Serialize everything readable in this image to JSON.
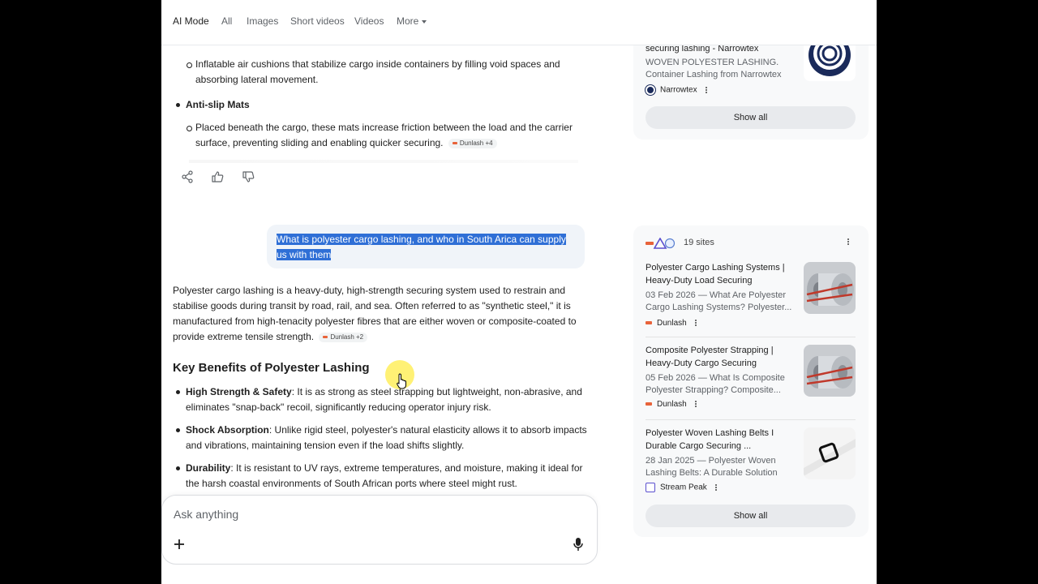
{
  "nav": {
    "tabs": [
      "AI Mode",
      "All",
      "Images",
      "Short videos",
      "Videos",
      "More"
    ]
  },
  "main": {
    "cushion_text": "Inflatable air cushions that stabilize cargo inside containers by filling void spaces and absorbing lateral movement.",
    "mats_heading": "Anti-slip Mats",
    "mats_text": "Placed beneath the cargo, these mats increase friction between the load and the carrier surface, preventing sliding and enabling quicker securing.",
    "mats_chip": "Dunlash +4",
    "user_query": "What is polyester cargo lashing, and who in South Arica can supply us with them",
    "answer_text": "Polyester cargo lashing is a heavy-duty, high-strength securing system used to restrain and stabilise goods during transit by road, rail, and sea. Often referred to as \"synthetic steel,\" it is manufactured from high-tenacity polyester fibres that are either woven or composite-coated to provide extreme tensile strength.",
    "answer_chip": "Dunlash +2",
    "benefits_title": "Key Benefits of Polyester Lashing",
    "benefits": [
      {
        "label": "High Strength & Safety",
        "text": ": It is as strong as steel strapping but lightweight, non-abrasive, and eliminates \"snap-back\" recoil, significantly reducing operator injury risk."
      },
      {
        "label": "Shock Absorption",
        "text": ": Unlike rigid steel, polyester's natural elasticity allows it to absorb impacts and vibrations, maintaining tension even if the load shifts slightly."
      },
      {
        "label": "Durability",
        "text": ": It is resistant to UV rays, extreme temperatures, and moisture, making it ideal for the harsh coastal environments of South African ports where steel might rust."
      }
    ]
  },
  "composer": {
    "placeholder": "Ask anything"
  },
  "sources_top": {
    "title": "securing lashing - Narrowtex",
    "snippet": "WOVEN POLYESTER LASHING. Container Lashing from Narrowtex is...",
    "site": "Narrowtex",
    "show_all": "Show all"
  },
  "sources": {
    "count_label": "19 sites",
    "items": [
      {
        "title": "Polyester Cargo Lashing Systems | Heavy-Duty Load Securing",
        "snippet": "03 Feb 2026 — What Are Polyester Cargo Lashing Systems? Polyester...",
        "site": "Dunlash"
      },
      {
        "title": "Composite Polyester Strapping | Heavy-Duty Cargo Securing",
        "snippet": "05 Feb 2026 — What Is Composite Polyester Strapping? Composite...",
        "site": "Dunlash"
      },
      {
        "title": "Polyester Woven Lashing Belts I Durable Cargo Securing ...",
        "snippet": "28 Jan 2025 — Polyester Woven Lashing Belts: A Durable Solution for...",
        "site": "Stream Peak"
      }
    ],
    "show_all": "Show all"
  },
  "colors": {
    "selection": "#2f6fd6",
    "dunlash_brand": "#e8633a",
    "narrowtex_brand": "#1a2a5a"
  },
  "icons": [
    "share-icon",
    "thumbs-up-icon",
    "thumbs-down-icon",
    "plus-icon",
    "mic-icon",
    "more-vert-icon",
    "cursor-icon"
  ]
}
